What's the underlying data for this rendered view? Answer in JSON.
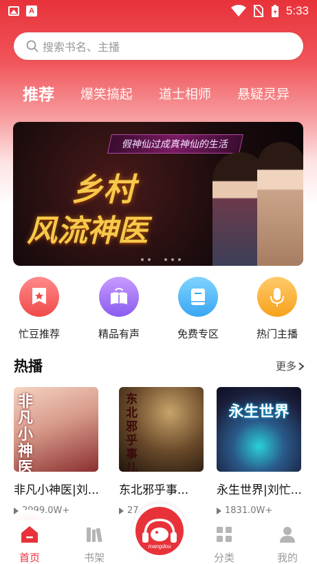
{
  "status_bar": {
    "time": "5:33",
    "icons": [
      "image-icon",
      "a-icon",
      "wifi-icon",
      "no-sim-icon",
      "battery-icon"
    ]
  },
  "search": {
    "placeholder": "搜索书名、主播"
  },
  "tabs": [
    {
      "label": "推荐",
      "active": true
    },
    {
      "label": "爆笑搞起",
      "active": false
    },
    {
      "label": "道士相师",
      "active": false
    },
    {
      "label": "悬疑灵异",
      "active": false
    }
  ],
  "banner": {
    "subtitle": "假神仙过成真神仙的生活",
    "title_line1": "乡村",
    "title_line2": "风流神医"
  },
  "categories": [
    {
      "label": "忙豆推荐",
      "icon": "badge-star-icon",
      "color": "#f04a4a"
    },
    {
      "label": "精品有声",
      "icon": "audio-book-icon",
      "color": "#8a5cf0"
    },
    {
      "label": "免费专区",
      "icon": "book-icon",
      "color": "#3aa6f3"
    },
    {
      "label": "热门主播",
      "icon": "microphone-icon",
      "color": "#f7a21b"
    }
  ],
  "hot": {
    "title": "热播",
    "more": "更多",
    "books": [
      {
        "title": "非凡小神医|刘...",
        "plays": "2999.0W+",
        "cover_text": "非凡小神医"
      },
      {
        "title": "东北邪乎事...",
        "plays": "27...",
        "cover_text": "东北邪乎事儿"
      },
      {
        "title": "永生世界|刘忙...",
        "plays": "1831.0W+",
        "cover_text": "永生世界"
      }
    ]
  },
  "tabbar": {
    "items": [
      {
        "label": "首页",
        "icon": "home-icon",
        "active": true
      },
      {
        "label": "书架",
        "icon": "bookshelf-icon",
        "active": false
      },
      {
        "label": "分类",
        "icon": "category-grid-icon",
        "active": false
      },
      {
        "label": "我的",
        "icon": "profile-icon",
        "active": false
      }
    ],
    "center_brand": "mangdou"
  },
  "colors": {
    "accent": "#e8323a"
  }
}
